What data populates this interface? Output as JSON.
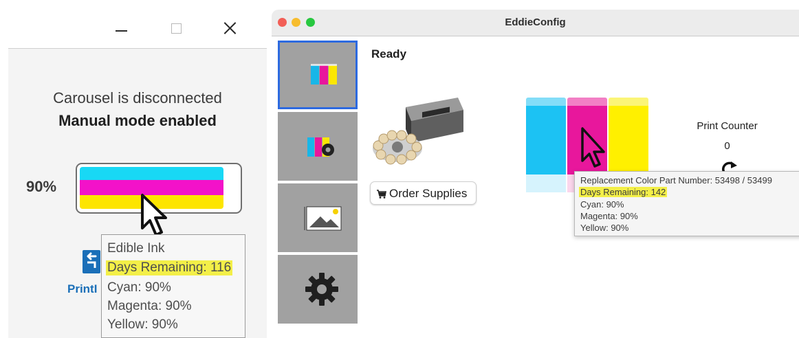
{
  "left_window": {
    "titlebar": {
      "minimize_icon": "minimize-icon",
      "maximize_icon": "maximize-icon",
      "close_icon": "close-icon"
    },
    "status_line1": "Carousel is disconnected",
    "status_line2": "Manual mode enabled",
    "ink": {
      "percent_label": "90%",
      "cyan_level": 0.9,
      "magenta_level": 0.9,
      "yellow_level": 0.9
    },
    "print_label": "PrintI",
    "tooltip": {
      "title": "Edible Ink",
      "days_remaining": "Days Remaining: 116",
      "cyan": "Cyan: 90%",
      "magenta": "Magenta: 90%",
      "yellow": "Yellow: 90%"
    },
    "colors": {
      "cyan": "#18d8f5",
      "magenta": "#f312c9",
      "yellow": "#fde500",
      "highlight": "#f3ef48"
    }
  },
  "mac_window": {
    "title": "EddieConfig",
    "status": "Ready",
    "order_button": "Order Supplies",
    "print_counter": {
      "label": "Print Counter",
      "value": "0"
    },
    "sidebar_tabs": [
      {
        "icon": "ink-cartridges-icon",
        "selected": true
      },
      {
        "icon": "ink-settings-icon",
        "selected": false
      },
      {
        "icon": "image-icon",
        "selected": false
      },
      {
        "icon": "gear-icon",
        "selected": false
      }
    ],
    "tooltip": {
      "part_number": "Replacement Color Part Number: 53498 / 53499",
      "days_remaining": "Days Remaining: 142",
      "cyan": "Cyan: 90%",
      "magenta": "Magenta: 90%",
      "yellow": "Yellow: 90%"
    },
    "colors": {
      "selected_tab": "#2d6ae0",
      "cyan": "#1cc2f3",
      "magenta": "#e8179c",
      "yellow": "#fff000",
      "traffic_red": "#f25f57",
      "traffic_yellow": "#f7bd2e",
      "traffic_green": "#28c840"
    }
  }
}
